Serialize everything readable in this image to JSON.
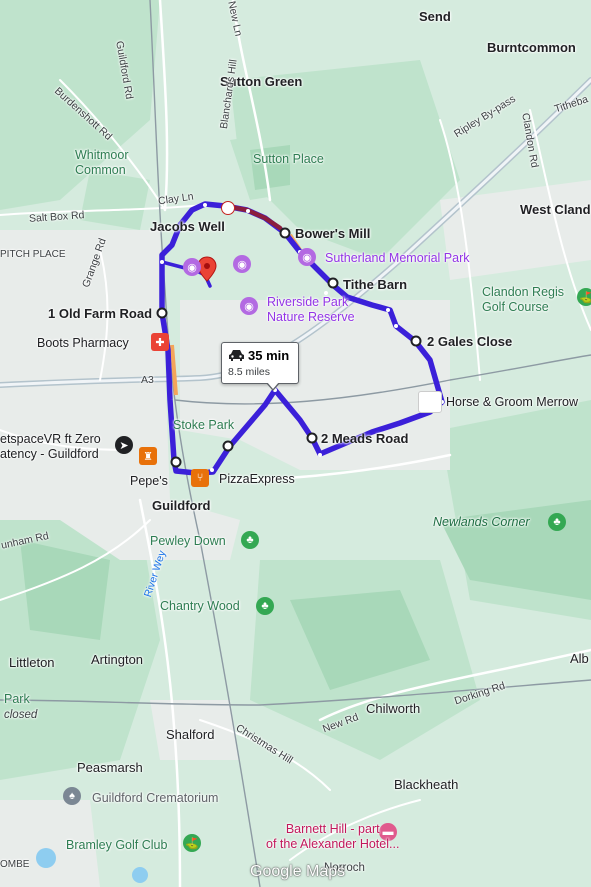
{
  "places": {
    "send": "Send",
    "burntcommon": "Burntcommon",
    "sutton_green": "Sutton Green",
    "whitmoor_common": "Whitmoor\nCommon",
    "sutton_place": "Sutton Place",
    "west_clandon": "West Cland",
    "jacobs_well": "Jacobs Well",
    "bowers_mill": "Bower's Mill",
    "sutherland": "Sutherland Memorial Park",
    "tithe_barn": "Tithe Barn",
    "clandon_regis": "Clandon Regis\nGolf Course",
    "riverside": "Riverside Park\nNature Reserve",
    "old_farm": "1 Old Farm Road",
    "gales_close": "2 Gales Close",
    "boots": "Boots Pharmacy",
    "horse_groom": "Horse & Groom Merrow",
    "getspace": "etspaceVR ft Zero\natency - Guildford",
    "stoke_park": "Stoke Park",
    "meads_road": "2 Meads Road",
    "pepes": "Pepe's",
    "pizzaexpress": "PizzaExpress",
    "guildford": "Guildford",
    "newlands": "Newlands Corner",
    "pewley": "Pewley Down",
    "chantry": "Chantry Wood",
    "littleton": "Littleton",
    "artington": "Artington",
    "albury": "Alb",
    "park": "Park",
    "closed": "closed",
    "chilworth": "Chilworth",
    "shalford": "Shalford",
    "peasmarsh": "Peasmarsh",
    "blackheath": "Blackheath",
    "crematorium": "Guildford Crematorium",
    "barnett": "Barnett Hill - part\nof the Alexander Hotel...",
    "bramley": "Bramley Golf Club",
    "pitch_place": "PITCH PLACE",
    "ombe": "OMBE",
    "norrroch": "Norroch"
  },
  "roads": {
    "guildford_rd": "Guildford Rd",
    "burdenshott": "Burdenshott Rd",
    "blanchards": "Blanchards Hill",
    "clay_ln": "Clay Ln",
    "salt_box": "Salt Box Rd",
    "grange": "Grange Rd",
    "new_ln": "New Ln",
    "ripley": "Ripley By-pass",
    "clandon_rd": "Clandon Rd",
    "tithebarn": "Titheba",
    "a3": "A3",
    "dorking": "Dorking Rd",
    "new_rd": "New Rd",
    "christmas": "Christmas Hill",
    "river_wey": "River Wey",
    "wonham": "unham Rd"
  },
  "route": {
    "time": "35 min",
    "distance": "8.5 miles",
    "color": "#3b20d9"
  },
  "branding": {
    "logo": "Google Maps"
  },
  "icons": {
    "pin": "location-pin-icon",
    "car": "car-icon",
    "camera": "camera-icon",
    "tree": "tree-icon",
    "golf": "golf-icon",
    "restaurant": "restaurant-icon",
    "pharmacy": "pharmacy-icon",
    "hotel": "hotel-icon",
    "vr": "vr-icon",
    "memorial": "memorial-icon"
  }
}
